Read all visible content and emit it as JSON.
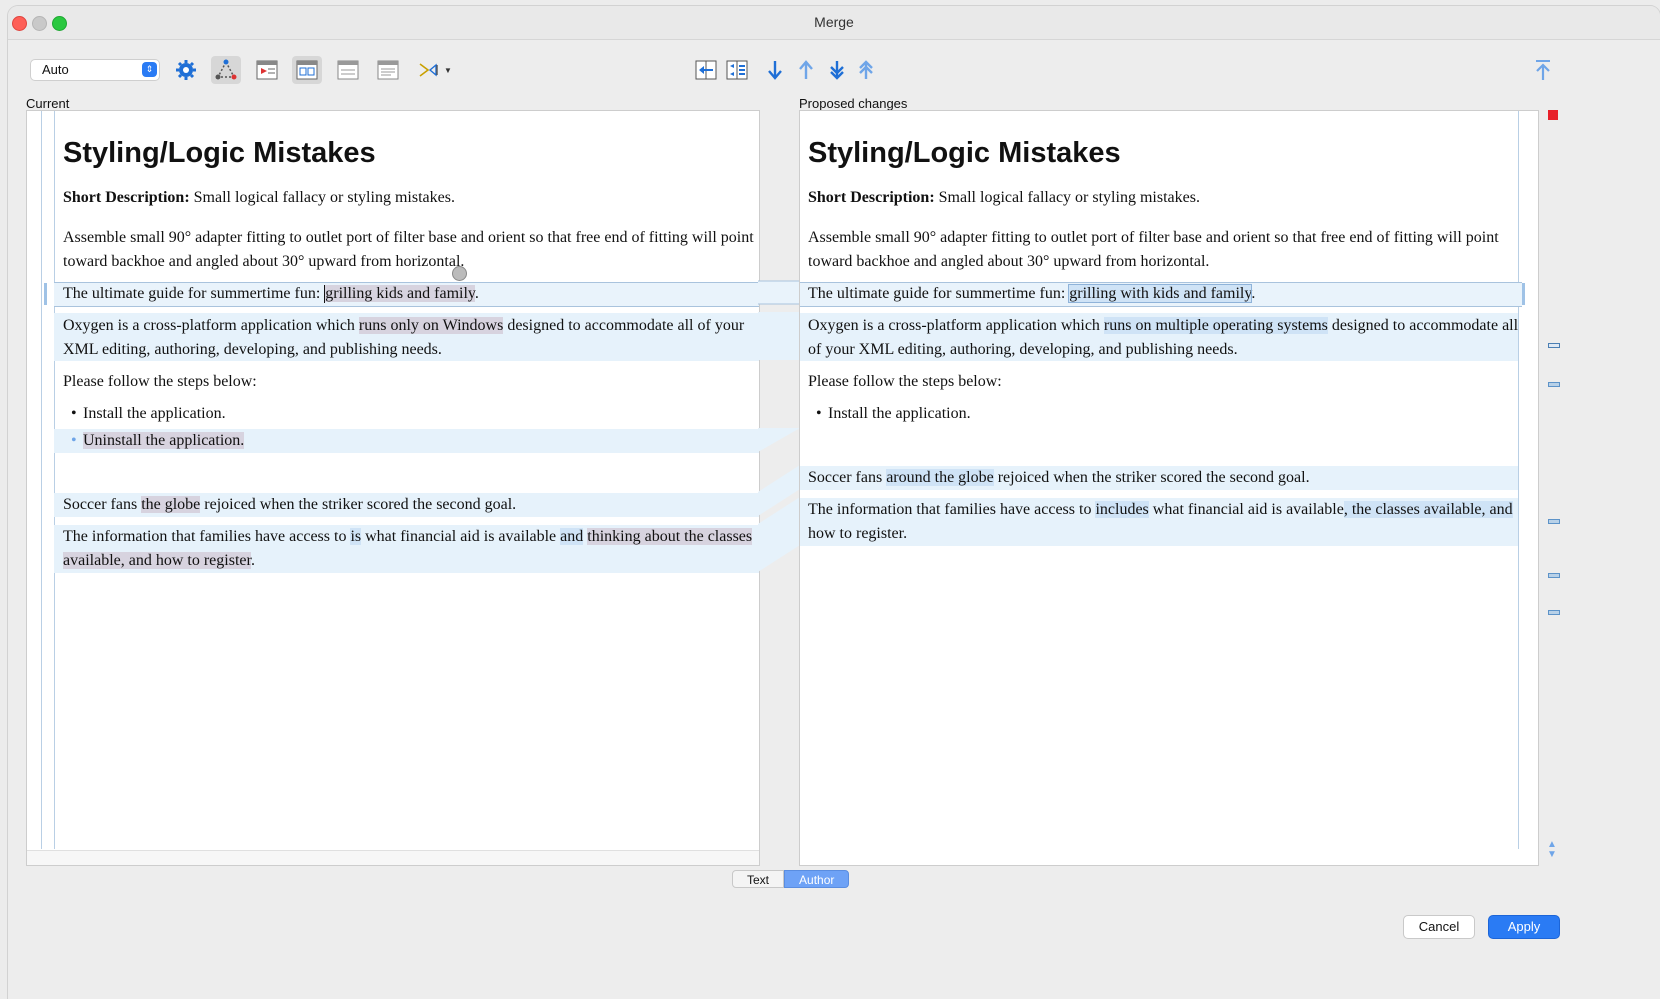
{
  "window": {
    "title": "Merge"
  },
  "toolbar": {
    "mode_value": "Auto",
    "left_icons": [
      "gear-icon",
      "three-way-merge-icon",
      "show-changes-icon",
      "layout-icon",
      "compare-icon",
      "inline-icon",
      "word-compare-icon"
    ],
    "nav_icons": [
      "copy-to-left-icon",
      "copy-all-icon",
      "next-change-icon",
      "previous-change-icon",
      "last-change-icon",
      "first-change-icon"
    ]
  },
  "panels": {
    "left_label": "Current",
    "right_label": "Proposed changes"
  },
  "left": {
    "title": "Styling/Logic Mistakes",
    "short_desc_label": "Short Description:",
    "short_desc_text": " Small logical fallacy or styling mistakes.",
    "p1_line1": "Assemble small 90° adapter fitting to outlet port of filter base and orient so that free end of fitting will point",
    "p1_line2": "toward backhoe and angled about 30° upward from horizontal.",
    "p2_pre": "The ultimate guide for summertime fun: ",
    "p2_hl": "grilling kids and family",
    "p2_post": ".",
    "p3_pre": "Oxygen is a cross-platform application which ",
    "p3_hl": "runs only on Windows",
    "p3_post": " designed to accommodate all of your",
    "p3_line2": "XML editing, authoring, developing, and publishing needs.",
    "p4": "Please follow the steps below:",
    "li1": "Install the application.",
    "li2": "Uninstall the application.",
    "p5_pre": "Soccer fans ",
    "p5_hl": "the globe",
    "p5_post": " rejoiced when the striker scored the second goal.",
    "p6_pre": "The information that families have access to ",
    "p6_hl1": "is",
    "p6_mid": " what financial aid is available ",
    "p6_hl2": "and",
    "p6_sp": " ",
    "p6_hl3": "thinking about the classes",
    "p6_line2_hl": "available, and how to register",
    "p6_line2_post": "."
  },
  "right": {
    "title": "Styling/Logic Mistakes",
    "short_desc_label": "Short Description:",
    "short_desc_text": " Small logical fallacy or styling mistakes.",
    "p1_line1": "Assemble small 90° adapter fitting to outlet port of filter base and orient so that free end of fitting will point",
    "p1_line2": "toward backhoe and angled about 30° upward from horizontal.",
    "p2_pre": "The ultimate guide for summertime fun: ",
    "p2_hl": "grilling with kids and family",
    "p2_post": ".",
    "p3_pre": "Oxygen is a cross-platform application which ",
    "p3_hl": "runs on multiple operating systems",
    "p3_post": " designed to accommodate all",
    "p3_line2": "of your XML editing, authoring, developing, and publishing needs.",
    "p4": "Please follow the steps below:",
    "li1": "Install the application.",
    "p5_pre": "Soccer fans ",
    "p5_hl": "around the globe",
    "p5_post": " rejoiced when the striker scored the second goal.",
    "p6_pre": "The information that families have access to ",
    "p6_hl1": "includes",
    "p6_mid": " what financial aid is available",
    "p6_hl2": ", the classes available, and",
    "p6_line2": "how to register."
  },
  "tabs": {
    "text": "Text",
    "author": "Author"
  },
  "buttons": {
    "cancel": "Cancel",
    "apply": "Apply"
  },
  "colors": {
    "accent": "#2a7bf4",
    "change_band": "#e6f2fb",
    "removed_highlight": "#d7d3df",
    "added_highlight": "#cfe3f6",
    "error_marker": "#e8202a"
  }
}
